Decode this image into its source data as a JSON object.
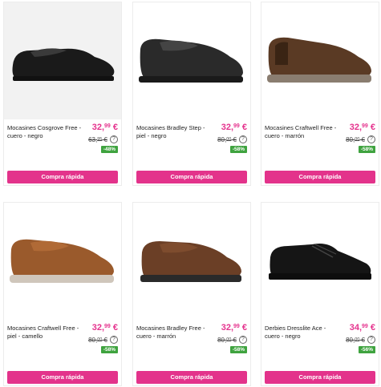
{
  "products": [
    {
      "name": "Mocasines Cosgrove Free - cuero - negro",
      "price": "32,",
      "price_cents": "99",
      "currency": "€",
      "old_price": "63,",
      "old_cents": "95",
      "discount": "-48%",
      "button": "Compra rápida",
      "shoe_color": "#1a1a1a",
      "sole_color": "#111111"
    },
    {
      "name": "Mocasines Bradley Step - piel - negro",
      "price": "32,",
      "price_cents": "99",
      "currency": "€",
      "old_price": "80,",
      "old_cents": "00",
      "discount": "-58%",
      "button": "Compra rápida",
      "shoe_color": "#2a2a2a",
      "sole_color": "#1a1a1a"
    },
    {
      "name": "Mocasines Craftwell Free - cuero - marrón",
      "price": "32,",
      "price_cents": "99",
      "currency": "€",
      "old_price": "80,",
      "old_cents": "00",
      "discount": "-58%",
      "button": "Compra rápida",
      "shoe_color": "#5a3a24",
      "sole_color": "#8a7d70"
    },
    {
      "name": "Mocasines Craftwell Free - piel - camello",
      "price": "32,",
      "price_cents": "99",
      "currency": "€",
      "old_price": "80,",
      "old_cents": "00",
      "discount": "-58%",
      "button": "Compra rápida",
      "shoe_color": "#9a5a2c",
      "sole_color": "#cfc6bb"
    },
    {
      "name": "Mocasines Bradley Free - cuero - marrón",
      "price": "32,",
      "price_cents": "99",
      "currency": "€",
      "old_price": "80,",
      "old_cents": "00",
      "discount": "-58%",
      "button": "Compra rápida",
      "shoe_color": "#6b3f26",
      "sole_color": "#2a2a2a"
    },
    {
      "name": "Derbies Dresslite Ace - cuero - negro",
      "price": "34,",
      "price_cents": "99",
      "currency": "€",
      "old_price": "80,",
      "old_cents": "00",
      "discount": "-56%",
      "button": "Compra rápida",
      "shoe_color": "#151515",
      "sole_color": "#0d0d0d"
    }
  ],
  "help_icon": "?"
}
